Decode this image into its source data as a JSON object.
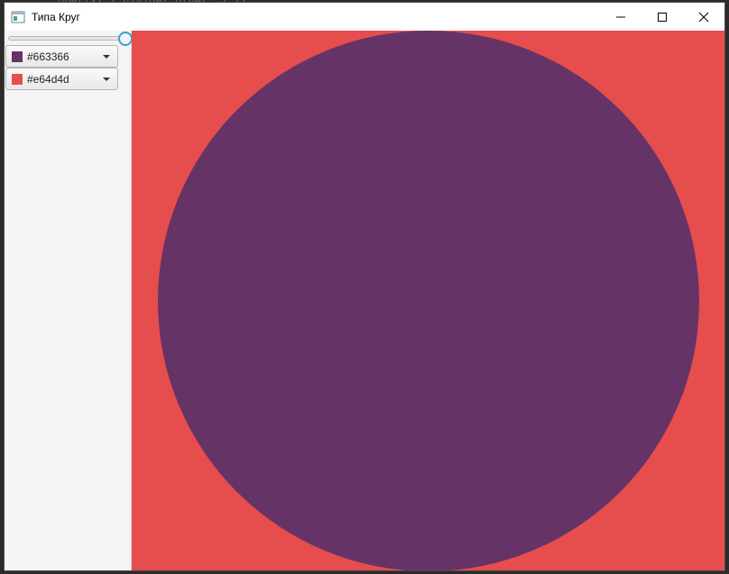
{
  "window": {
    "title": "Типа Круг"
  },
  "sidebar": {
    "slider": {
      "value": 1.0
    },
    "fill_picker": {
      "label": "#663366",
      "color": "#663366"
    },
    "background_picker": {
      "label": "#e64d4d",
      "color": "#e64d4d"
    }
  },
  "canvas": {
    "background_color": "#e64d4d",
    "circle_color": "#663366"
  },
  "icons": {
    "app": "app-window-icon",
    "minimize": "minimize-icon",
    "maximize": "maximize-icon",
    "close": "close-icon"
  }
}
